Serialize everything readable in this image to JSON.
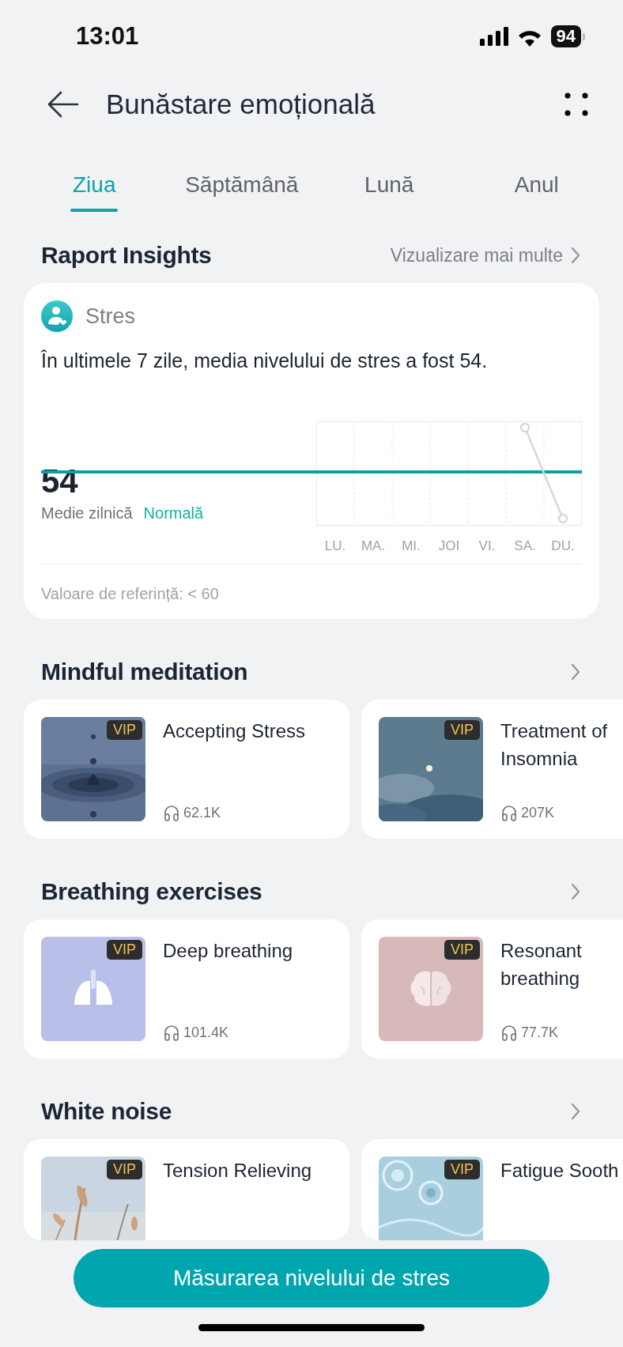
{
  "status_bar": {
    "time": "13:01",
    "battery": "94"
  },
  "header": {
    "title": "Bunăstare emoțională"
  },
  "tabs": [
    {
      "label": "Ziua",
      "selected": true
    },
    {
      "label": "Săptămână",
      "selected": false
    },
    {
      "label": "Lună",
      "selected": false
    },
    {
      "label": "Anul",
      "selected": false
    }
  ],
  "insights": {
    "title": "Raport Insights",
    "more_link": "Vizualizare mai multe",
    "card": {
      "title": "Stres",
      "summary": "În ultimele 7 zile, media nivelului de stres a fost 54.",
      "average": "54",
      "average_label": "Medie zilnică",
      "status": "Normală",
      "days": [
        "LU.",
        "MA.",
        "MI.",
        "JOI",
        "VI.",
        "SA.",
        "DU."
      ],
      "reference": "Valoare de referință: < 60"
    }
  },
  "sections": [
    {
      "title": "Mindful meditation",
      "items": [
        {
          "title": "Accepting Stress",
          "badge": "VIP",
          "listens": "62.1K",
          "kind": "water-drop"
        },
        {
          "title": "Treatment of Insomnia",
          "badge": "VIP",
          "listens": "207K",
          "kind": "sky"
        }
      ]
    },
    {
      "title": "Breathing exercises",
      "items": [
        {
          "title": "Deep breathing",
          "badge": "VIP",
          "listens": "101.4K",
          "kind": "lungs"
        },
        {
          "title": "Resonant breathing",
          "badge": "VIP",
          "listens": "77.7K",
          "kind": "brain"
        }
      ]
    },
    {
      "title": "White noise",
      "items": [
        {
          "title": "Tension Relieving",
          "badge": "VIP",
          "kind": "reeds"
        },
        {
          "title": "Fatigue Sooth",
          "badge": "VIP",
          "kind": "ripples"
        }
      ]
    }
  ],
  "action_button": "Măsurarea nivelului de stres"
}
